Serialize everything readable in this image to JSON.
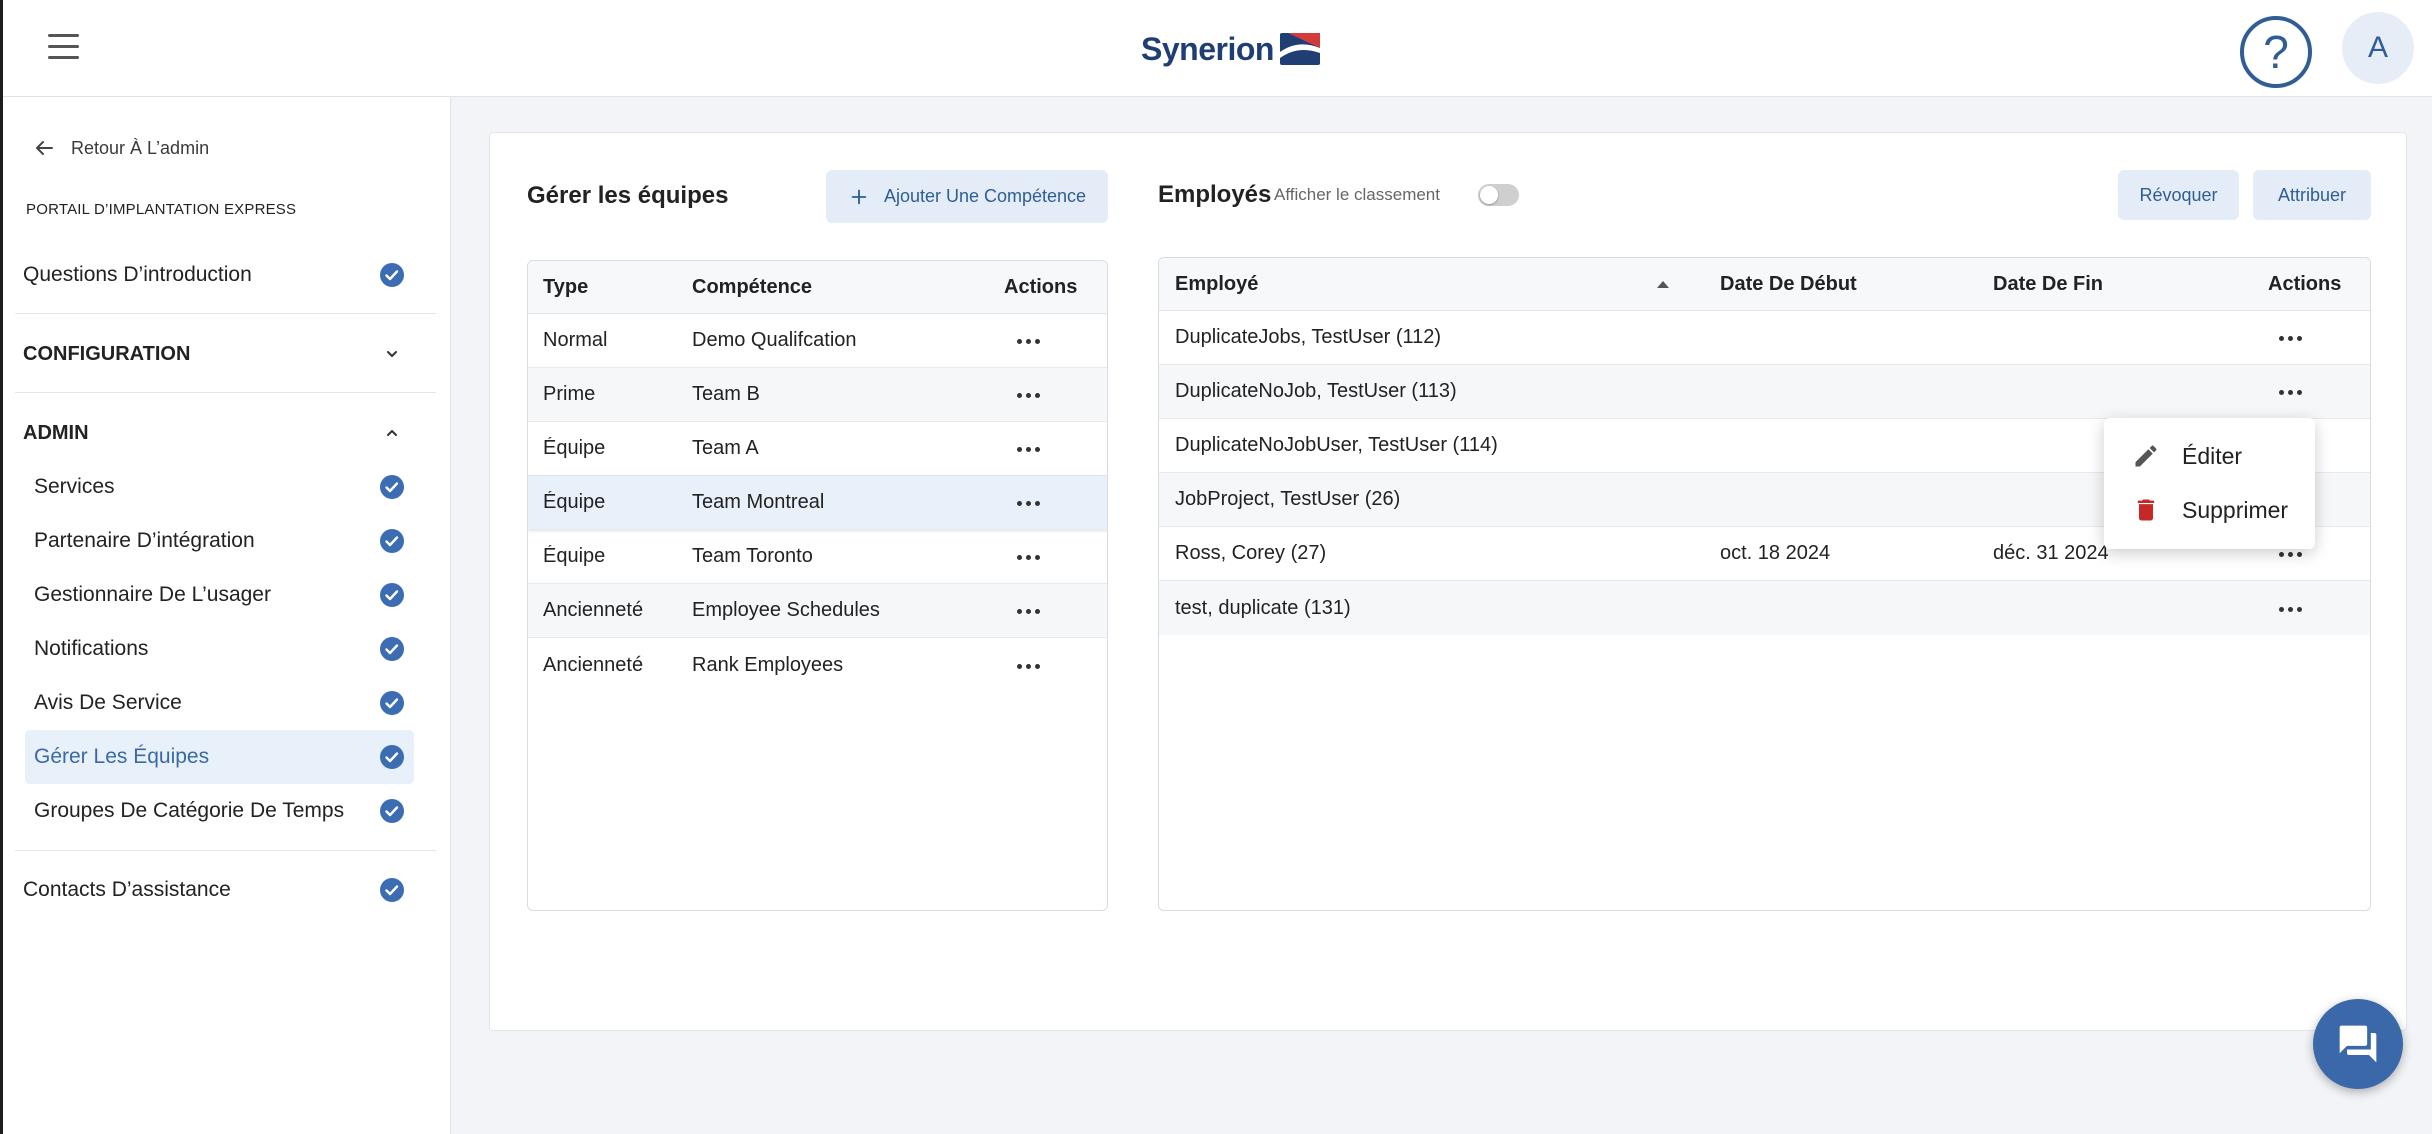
{
  "header": {
    "menu_icon": "menu-icon",
    "logo_text": "Synerion",
    "logo_icon": "synerion-flag-logo",
    "help_icon": "help-circle-icon",
    "help_glyph": "?",
    "avatar_initial": "A"
  },
  "sidebar": {
    "back": {
      "label": "Retour À L’admin",
      "icon": "arrow-left-icon"
    },
    "portal_title": "PORTAIL D’IMPLANTATION EXPRESS",
    "intro": {
      "label": "Questions D’introduction",
      "icon": "check-circle-icon"
    },
    "configuration": {
      "label": "CONFIGURATION",
      "expanded": false,
      "icon": "chevron-down-icon"
    },
    "admin": {
      "label": "ADMIN",
      "expanded": true,
      "icon": "chevron-up-icon",
      "items": [
        {
          "label": "Services",
          "icon": "check-circle-icon",
          "selected": false
        },
        {
          "label": "Partenaire D’intégration",
          "icon": "check-circle-icon",
          "selected": false
        },
        {
          "label": "Gestionnaire De L’usager",
          "icon": "check-circle-icon",
          "selected": false
        },
        {
          "label": "Notifications",
          "icon": "check-circle-icon",
          "selected": false
        },
        {
          "label": "Avis De Service",
          "icon": "check-circle-icon",
          "selected": false
        },
        {
          "label": "Gérer Les Équipes",
          "icon": "check-circle-icon",
          "selected": true
        },
        {
          "label": "Groupes De Catégorie De Temps",
          "icon": "check-circle-icon",
          "selected": false
        }
      ]
    },
    "support": {
      "label": "Contacts D’assistance",
      "icon": "check-circle-icon"
    }
  },
  "teams": {
    "title": "Gérer les équipes",
    "add_button": {
      "label": "Ajouter Une Compétence",
      "icon": "plus-icon"
    },
    "columns": {
      "type": "Type",
      "skill": "Compétence",
      "actions": "Actions"
    },
    "selected_row": 3,
    "row_action_icon": "more-horizontal-icon",
    "rows": [
      {
        "type": "Normal",
        "skill": "Demo Qualifcation"
      },
      {
        "type": "Prime",
        "skill": "Team B"
      },
      {
        "type": "Équipe",
        "skill": "Team A"
      },
      {
        "type": "Équipe",
        "skill": "Team Montreal"
      },
      {
        "type": "Équipe",
        "skill": "Team Toronto"
      },
      {
        "type": "Ancienneté",
        "skill": "Employee Schedules"
      },
      {
        "type": "Ancienneté",
        "skill": "Rank Employees"
      }
    ]
  },
  "employees": {
    "title": "Employés",
    "show_ranking": {
      "label": "Afficher le classement",
      "on": false
    },
    "revoke_label": "Révoquer",
    "assign_label": "Attribuer",
    "columns": {
      "employee": "Employé",
      "start": "Date De Début",
      "end": "Date De Fin",
      "actions": "Actions"
    },
    "sort": {
      "column": "Employé",
      "direction": "ascending",
      "icon": "sort-up-icon"
    },
    "row_action_icon": "more-horizontal-icon",
    "rows": [
      {
        "employee": "DuplicateJobs, TestUser (112)",
        "start": "",
        "end": ""
      },
      {
        "employee": "DuplicateNoJob, TestUser (113)",
        "start": "",
        "end": ""
      },
      {
        "employee": "DuplicateNoJobUser, TestUser (114)",
        "start": "",
        "end": ""
      },
      {
        "employee": "JobProject, TestUser (26)",
        "start": "",
        "end": ""
      },
      {
        "employee": "Ross, Corey (27)",
        "start": "oct. 18 2024",
        "end": "déc. 31 2024"
      },
      {
        "employee": "test, duplicate (131)",
        "start": "",
        "end": ""
      }
    ]
  },
  "row_menu": {
    "open": true,
    "anchor_row": 1,
    "items": [
      {
        "label": "Éditer",
        "icon": "pencil-icon"
      },
      {
        "label": "Supprimer",
        "icon": "trash-icon"
      }
    ]
  },
  "chat_button": {
    "icon": "chat-icon"
  },
  "colors": {
    "accent": "#2f5d95",
    "check": "#3c6db3",
    "button_bg": "#e4edf7",
    "selected_bg": "#e8f0f9",
    "danger": "#c62828",
    "chat_button": "#3a68a8",
    "logo_navy": "#1f3e74"
  }
}
